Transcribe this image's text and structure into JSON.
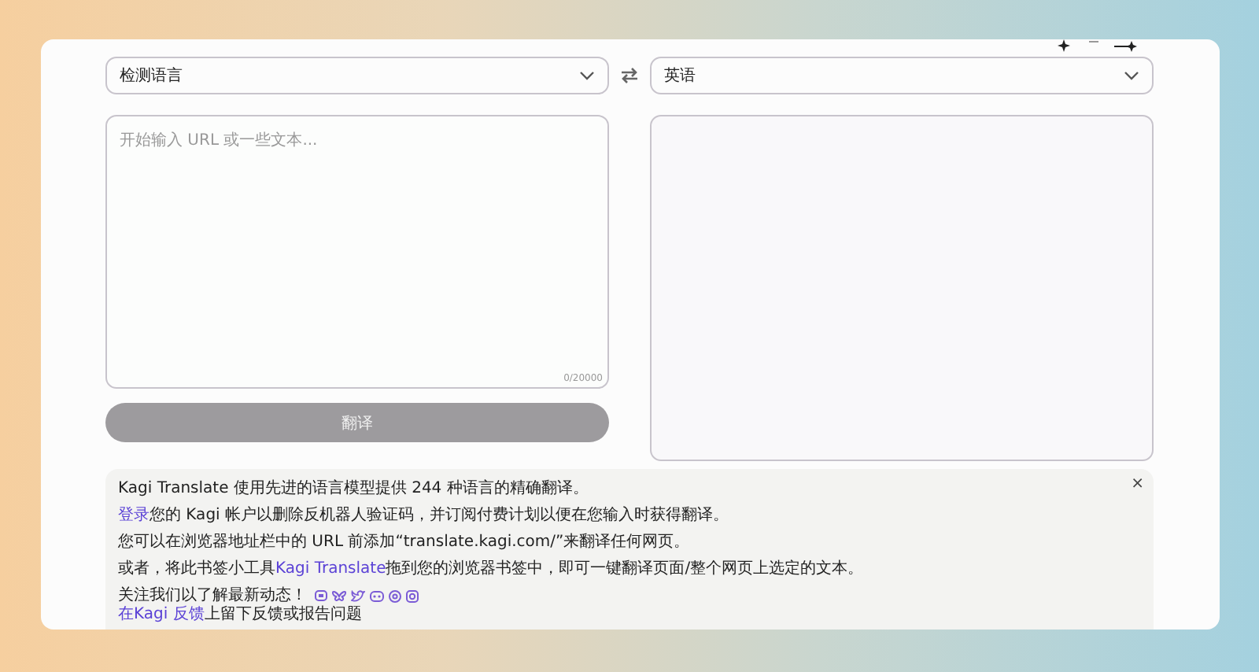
{
  "source_language": {
    "value": "检测语言"
  },
  "target_language": {
    "value": "英语"
  },
  "input": {
    "placeholder": "开始输入 URL 或一些文本...",
    "char_count": "0/20000"
  },
  "translate_button": {
    "label": "翻译",
    "disabled": true
  },
  "info": {
    "close": "×",
    "paragraphs": [
      [
        {
          "text": "Kagi Translate 使用先进的语言模型提供 244 种语言的精确翻译。",
          "link": false
        }
      ],
      [
        {
          "text": "登录",
          "link": true
        },
        {
          "text": "您的 Kagi 帐户以删除反机器人验证码，并订阅付费计划以便在您输入时获得翻译。",
          "link": false
        }
      ],
      [
        {
          "text": "您可以在浏览器地址栏中的 URL 前添加“translate.kagi.com/”来翻译任何网页。",
          "link": false
        }
      ],
      [
        {
          "text": "或者，将此书签小工具",
          "link": false
        },
        {
          "text": "Kagi Translate",
          "link": true
        },
        {
          "text": "拖到您的浏览器书签中，即可一键翻译页面/整个网页上选定的文本。",
          "link": false
        }
      ]
    ],
    "follow": "关注我们以了解最新动态！",
    "feedback": [
      {
        "text": "在Kagi 反馈",
        "link": true
      },
      {
        "text": "上留下反馈或报告问题",
        "link": false
      }
    ]
  }
}
